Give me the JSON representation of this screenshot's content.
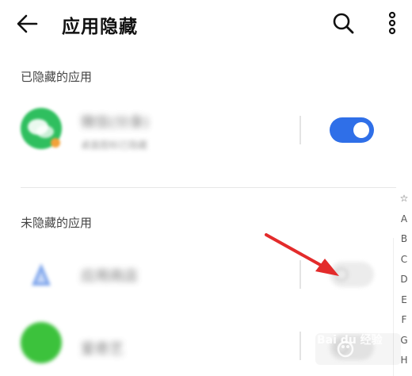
{
  "header": {
    "title": "应用隐藏",
    "back_icon": "arrow-left-icon",
    "search_icon": "search-icon",
    "more_icon": "more-vertical-icon"
  },
  "hidden_section": {
    "label": "已隐藏的应用",
    "apps": [
      {
        "name": "微信(分身)",
        "subtitle": "桌面图标已隐藏",
        "icon": "wechat-clone-icon",
        "icon_color": "#2fbf5f",
        "hidden": true
      }
    ]
  },
  "visible_section": {
    "label": "未隐藏的应用",
    "apps": [
      {
        "name": "应用商店",
        "icon": "app-store-icon",
        "icon_color": "#5b8ee6",
        "hidden": false
      },
      {
        "name": "爱奇艺",
        "icon": "green-app-icon",
        "icon_color": "#3cc23c",
        "hidden": false
      }
    ]
  },
  "alpha_index": [
    "☆",
    "A",
    "B",
    "C",
    "D",
    "E",
    "F",
    "G",
    "H"
  ],
  "colors": {
    "toggle_on": "#2f6fe8",
    "toggle_off": "#e6e6e6",
    "annotation_arrow": "#e32b2b"
  },
  "watermark": "Bai du 经验"
}
